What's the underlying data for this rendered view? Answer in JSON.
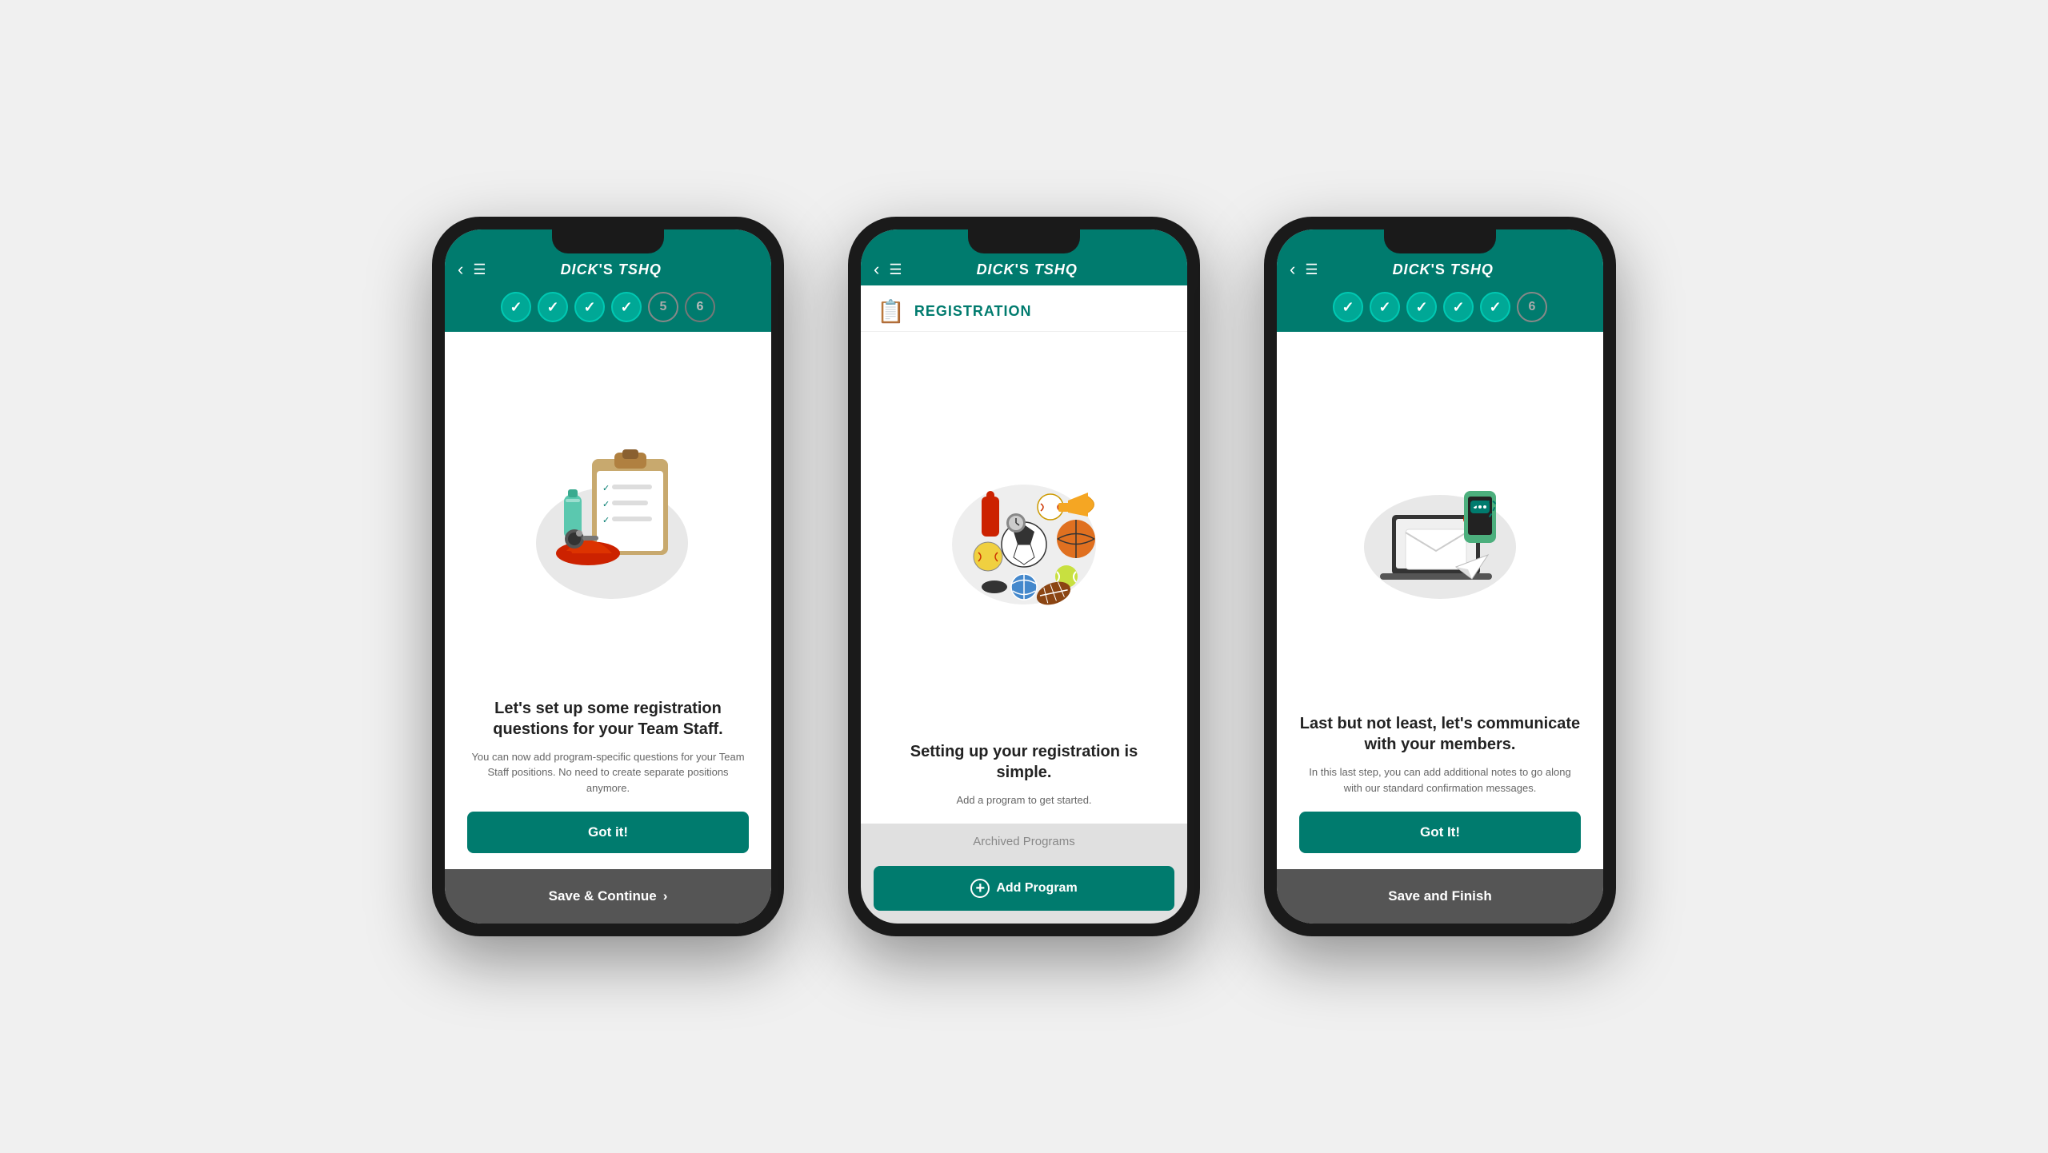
{
  "phones": [
    {
      "id": "phone1",
      "header": {
        "back_label": "‹",
        "menu_label": "☰",
        "logo": "DICK'S TSHQ"
      },
      "steps": [
        {
          "type": "done",
          "num": ""
        },
        {
          "type": "done",
          "num": ""
        },
        {
          "type": "done",
          "num": ""
        },
        {
          "type": "done",
          "num": ""
        },
        {
          "type": "active",
          "num": "5"
        },
        {
          "type": "pending",
          "num": "6"
        }
      ],
      "content": {
        "headline": "Let's set up some registration questions for your Team Staff.",
        "subtext": "You can now add program-specific questions for your Team Staff positions. No need to create separate positions anymore.",
        "button_label": "Got it!",
        "illustration_type": "clipboard"
      },
      "bottom_bar": {
        "label": "Save & Continue",
        "arrow": "›"
      }
    },
    {
      "id": "phone2",
      "header": {
        "back_label": "‹",
        "menu_label": "☰",
        "logo": "DICK'S TSHQ"
      },
      "steps": [],
      "content": {
        "reg_title": "REGISTRATION",
        "headline": "Setting up your registration is simple.",
        "subtext": "Add a program to get started.",
        "illustration_type": "sports",
        "archived_label": "Archived Programs",
        "add_program_label": "Add Program",
        "plus_icon": "+"
      }
    },
    {
      "id": "phone3",
      "header": {
        "back_label": "‹",
        "menu_label": "☰",
        "logo": "DICK'S TSHQ"
      },
      "steps": [
        {
          "type": "done",
          "num": ""
        },
        {
          "type": "done",
          "num": ""
        },
        {
          "type": "done",
          "num": ""
        },
        {
          "type": "done",
          "num": ""
        },
        {
          "type": "done",
          "num": ""
        },
        {
          "type": "active",
          "num": "6"
        }
      ],
      "content": {
        "headline": "Last but not least, let's communicate with your members.",
        "subtext": "In this last step, you can add additional notes to go along with our standard confirmation messages.",
        "button_label": "Got It!",
        "illustration_type": "communication"
      },
      "bottom_bar": {
        "label": "Save and Finish",
        "arrow": ""
      }
    }
  ]
}
